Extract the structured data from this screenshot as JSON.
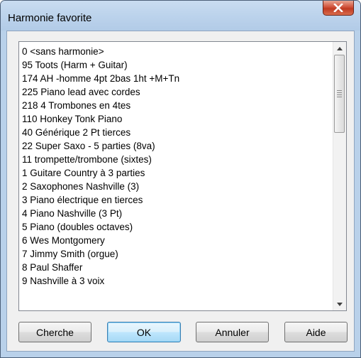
{
  "window": {
    "title": "Harmonie favorite"
  },
  "harmony_list": {
    "items": [
      "0 <sans harmonie>",
      "95 Toots (Harm + Guitar)",
      "174 AH -homme 4pt 2bas 1ht +M+Tn",
      "225 Piano lead avec cordes",
      "218 4 Trombones en 4tes",
      "110 Honkey Tonk Piano",
      "40 Générique 2 Pt tierces",
      "22 Super Saxo - 5 parties (8va)",
      "11 trompette/trombone (sixtes)",
      "1 Guitare Country à 3 parties",
      "2 Saxophones Nashville (3)",
      "3 Piano électrique en tierces",
      "4 Piano Nashville (3 Pt)",
      "5 Piano (doubles octaves)",
      "6 Wes Montgomery",
      "7 Jimmy Smith (orgue)",
      "8 Paul Shaffer",
      "9 Nashville à 3 voix"
    ]
  },
  "buttons": {
    "search": "Cherche",
    "ok": "OK",
    "cancel": "Annuler",
    "help": "Aide"
  },
  "colors": {
    "frame": "#b9d1ea",
    "close_button": "#c7432b",
    "default_button_border": "#3c7fb1"
  }
}
